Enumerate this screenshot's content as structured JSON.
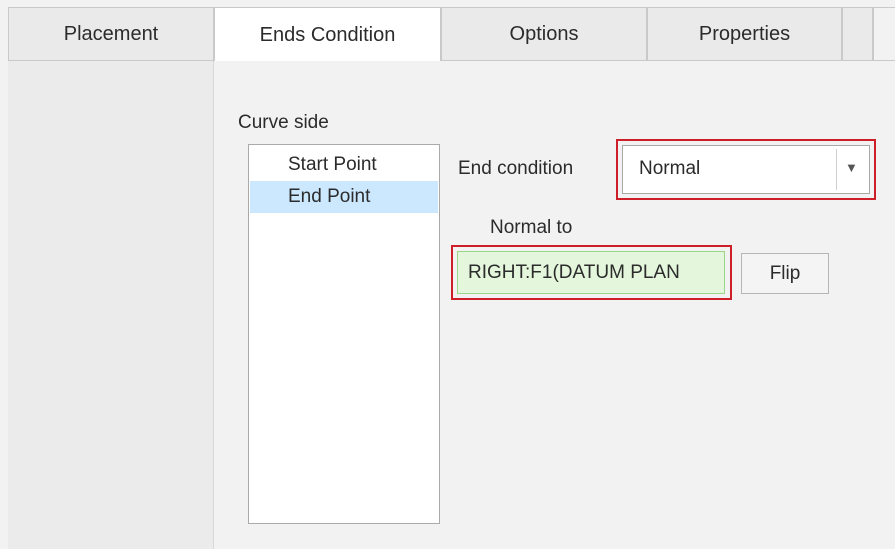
{
  "tabs": [
    {
      "label": "Placement"
    },
    {
      "label": "Ends Condition"
    },
    {
      "label": "Options"
    },
    {
      "label": "Properties"
    }
  ],
  "active_tab": "Ends Condition",
  "curve_side": {
    "label": "Curve side",
    "items": [
      {
        "label": "Start Point"
      },
      {
        "label": "End Point"
      }
    ],
    "selected": "End Point"
  },
  "end_condition": {
    "label": "End condition",
    "value": "Normal"
  },
  "normal_to": {
    "label": "Normal to",
    "value": "RIGHT:F1(DATUM PLAN"
  },
  "flip_button": {
    "label": "Flip"
  },
  "colors": {
    "highlight": "#cc1f2a",
    "selection": "#cce8ff",
    "ref_field_bg": "#e4f7dc"
  }
}
